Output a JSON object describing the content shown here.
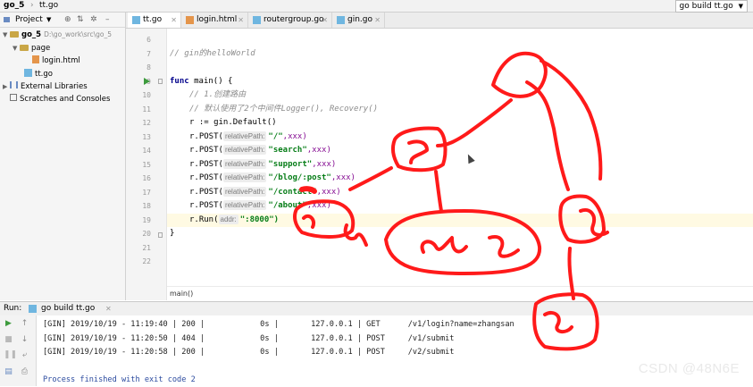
{
  "navbar": {
    "project": "go_5",
    "file": "tt.go",
    "run_config": "go build tt.go"
  },
  "project_panel": {
    "title": "Project",
    "tree": [
      {
        "label": "go_5",
        "path": "D:\\go_work\\src\\go_5",
        "type": "folder"
      },
      {
        "label": "page",
        "type": "folder"
      },
      {
        "label": "login.html",
        "type": "html"
      },
      {
        "label": "tt.go",
        "type": "go"
      },
      {
        "label": "External Libraries",
        "type": "libs"
      },
      {
        "label": "Scratches and Consoles",
        "type": "scratch"
      }
    ]
  },
  "tabs": [
    {
      "label": "tt.go",
      "active": true
    },
    {
      "label": "login.html",
      "active": false
    },
    {
      "label": "routergroup.go",
      "active": false
    },
    {
      "label": "gin.go",
      "active": false
    }
  ],
  "editor": {
    "line_numbers": [
      "6",
      "7",
      "8",
      "9",
      "10",
      "11",
      "12",
      "13",
      "14",
      "15",
      "16",
      "17",
      "18",
      "19",
      "20",
      "21",
      "22"
    ],
    "comment_hello": "// gin的helloWorld",
    "func_kw": "func",
    "func_rest": " main() {",
    "comment_1": "// 1.创建路由",
    "comment_2": "// 默认使用了2个中间件Logger(), Recovery()",
    "line_default": "r := gin.Default()",
    "post_prefix": "r.POST(",
    "hint_relative": "relativePath:",
    "route1": "\"/\"",
    "route2": "\"search\"",
    "route3": "\"support\"",
    "route4": "\"/blog/:post\"",
    "route5": "\"/contact\"",
    "route6": "\"/about\"",
    "handler": ",xxx)",
    "run_prefix": "r.Run(",
    "hint_addr": "addr:",
    "run_arg": "\":8000\")",
    "close_brace": "}",
    "bottom_crumb": "main()"
  },
  "run_panel": {
    "label": "Run:",
    "tab": "go build tt.go",
    "lines": [
      "[GIN] 2019/10/19 - 11:19:40 | 200 |            0s |       127.0.0.1 | GET      /v1/login?name=zhangsan",
      "[GIN] 2019/10/19 - 11:20:50 | 404 |            0s |       127.0.0.1 | POST     /v1/submit",
      "[GIN] 2019/10/19 - 11:20:58 | 200 |            0s |       127.0.0.1 | POST     /v2/submit"
    ],
    "exit_line": "Process finished with exit code 2"
  },
  "watermark": "CSDN @48N6E",
  "colors": {
    "scribble": "#ff1a1a",
    "run_green": "#3d9b3d",
    "comment": "#8c8c8c",
    "string": "#067d17"
  }
}
